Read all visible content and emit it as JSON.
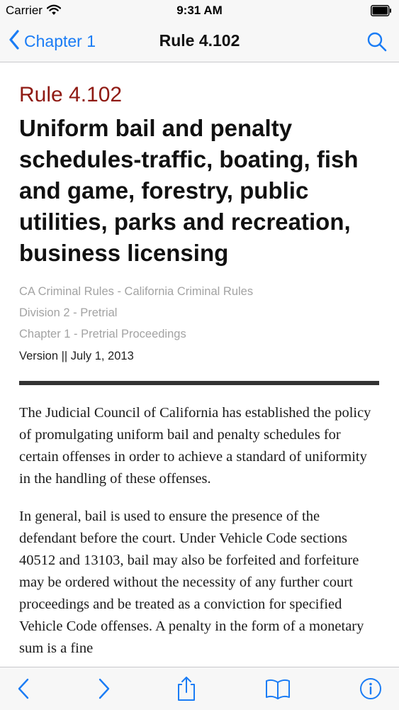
{
  "status_bar": {
    "carrier": "Carrier",
    "time": "9:31 AM"
  },
  "nav": {
    "back_label": "Chapter 1",
    "title": "Rule 4.102"
  },
  "article": {
    "rule_number": "Rule 4.102",
    "title": "Uniform bail and penalty schedules-traffic, boating, fish and game, forestry, public utilities, parks and recreation, business licensing",
    "breadcrumbs": [
      "CA Criminal Rules - California Criminal Rules",
      "Division 2 - Pretrial",
      "Chapter 1 - Pretrial Proceedings"
    ],
    "version": "Version || July 1, 2013",
    "paragraphs": [
      "The Judicial Council of California has established the policy of promulgating uniform bail and penalty schedules for certain offenses in order to achieve a standard of uniformity in the handling of these offenses.",
      "In general, bail is used to ensure the presence of the defendant before the court. Under Vehicle Code sections 40512 and 13103, bail may also be forfeited and forfeiture may be ordered without the necessity of any further court proceedings and be treated as a conviction for specified Vehicle Code offenses. A penalty in the form of a monetary sum is a fine"
    ]
  },
  "colors": {
    "accent": "#1a7cf5",
    "rule_number": "#8f1a13",
    "breadcrumb": "#a3a3a3"
  },
  "toolbar": {
    "icons": [
      "chevron-left-icon",
      "chevron-right-icon",
      "share-icon",
      "book-icon",
      "info-icon"
    ]
  }
}
